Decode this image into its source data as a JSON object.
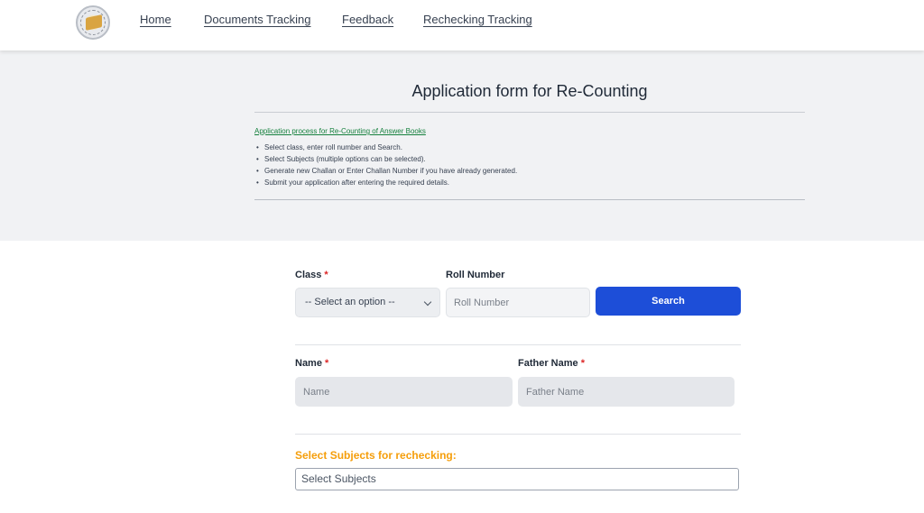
{
  "nav": {
    "links": [
      {
        "label": "Home"
      },
      {
        "label": "Documents Tracking"
      },
      {
        "label": "Feedback"
      },
      {
        "label": "Rechecking Tracking"
      }
    ]
  },
  "hero": {
    "title": "Application form for Re-Counting",
    "process_link": "Application process for Re-Counting of Answer Books",
    "steps": [
      "Select class, enter roll number and Search.",
      "Select Subjects (multiple options can be selected).",
      "Generate new Challan or Enter Challan Number if you have already generated.",
      "Submit your application after entering the required details."
    ]
  },
  "form": {
    "class_label": "Class",
    "required_mark": "*",
    "class_select_value": "-- Select an option --",
    "roll_label": "Roll Number",
    "roll_placeholder": "Roll Number",
    "search_label": "Search",
    "name_label": "Name",
    "name_placeholder": "Name",
    "father_label": "Father Name",
    "father_placeholder": "Father Name",
    "subjects_label": "Select Subjects for rechecking:",
    "subjects_placeholder": "Select Subjects"
  },
  "colors": {
    "primary_button": "#1d4ed8",
    "required": "#dc2626",
    "subjects_label": "#f59e0b",
    "process_link": "#15803d"
  },
  "icons": {
    "logo": "board-seal-logo",
    "select_arrow": "chevron-down-icon"
  }
}
